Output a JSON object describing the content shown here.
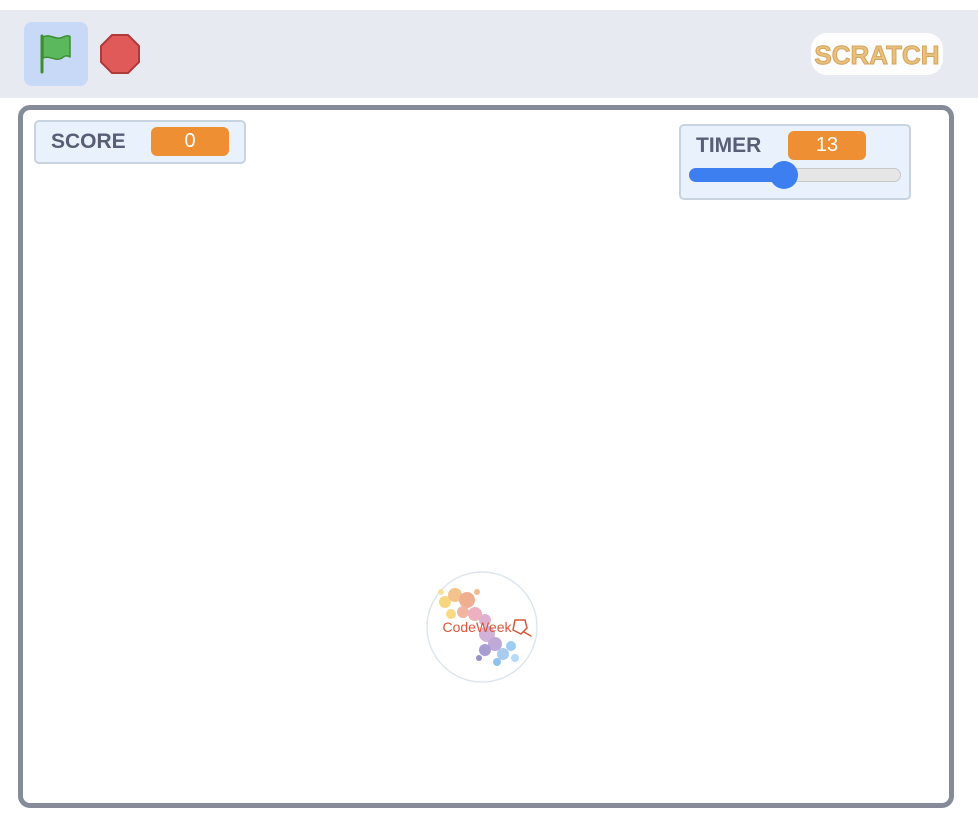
{
  "toolbar": {
    "green_flag_icon": "green-flag-icon",
    "stop_icon": "stop-sign-icon",
    "logo_text": "SCRATCH",
    "colors": {
      "flag": "#5cb85c",
      "stop": "#e05a5a",
      "logo": "#e8c17f"
    }
  },
  "stage": {
    "score_monitor": {
      "label": "SCORE",
      "value": "0"
    },
    "timer_monitor": {
      "label": "TIMER",
      "value": "13",
      "slider_fraction": 0.45
    },
    "sprite": {
      "text": "CodeWeek"
    },
    "colors": {
      "monitor_value": "#ef8f33",
      "slider": "#3d7ef0"
    }
  }
}
